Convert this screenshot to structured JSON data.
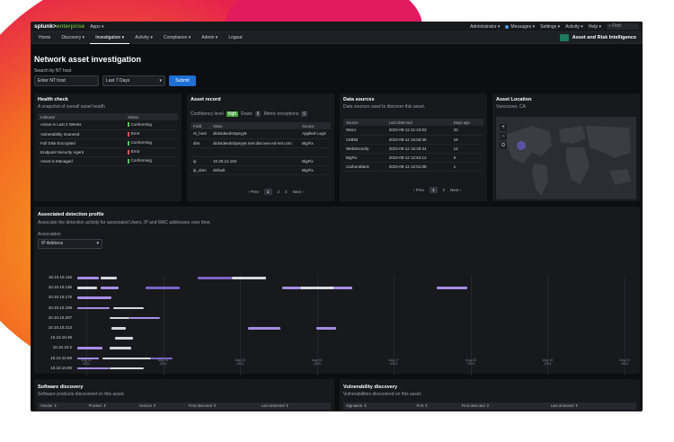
{
  "topbar": {
    "logo_main": "splunk>",
    "logo_ent": "enterprise",
    "app_menu": "Apps ▾",
    "admin": "Administrator ▾",
    "messages": "Messages ▾",
    "settings": "Settings ▾",
    "activity": "Activity ▾",
    "help": "Help ▾",
    "find": "Find"
  },
  "nav": {
    "items": [
      {
        "label": "Home"
      },
      {
        "label": "Discovery ▾"
      },
      {
        "label": "Investigation ▾"
      },
      {
        "label": "Activity ▾"
      },
      {
        "label": "Compliance ▾"
      },
      {
        "label": "Admin ▾"
      },
      {
        "label": "Logout"
      }
    ],
    "app_title": "Asset and Risk Intelligence"
  },
  "page": {
    "title": "Network asset investigation",
    "search_label": "Search by NT host",
    "input_value": "Enter NT host",
    "time_range": "Last 7 Days",
    "submit": "Submit"
  },
  "health": {
    "title": "Health check",
    "subtitle": "A snapshot of overall asset health",
    "headers": [
      "Indicator",
      "Status"
    ],
    "rows": [
      [
        "Active in Last 2 Weeks",
        "Conforming",
        "green"
      ],
      [
        "Vulnerability Scanned",
        "Error",
        "red"
      ],
      [
        "Full Disk Encrypted",
        "Conforming",
        "green"
      ],
      [
        "Endpoint Security Agent",
        "Error",
        "red"
      ],
      [
        "Asset is Managed",
        "Conforming",
        "green"
      ]
    ]
  },
  "asset": {
    "title": "Asset record",
    "conf_label": "Confidency level",
    "conf_value": "high",
    "rows_label": "Rows",
    "rows_value": "5",
    "metric_label": "Metric exceptions",
    "metric_value": "0",
    "headers": [
      "Field",
      "Value",
      "Source"
    ],
    "rows": [
      [
        "nt_host",
        "dicksdeedsSpeyy6",
        "Applied Logic"
      ],
      [
        "dns",
        "dicksdeedsSpeyy6.mer.discover.ed-net.com",
        "BigFix"
      ],
      [
        "",
        "",
        ""
      ],
      [
        "ip",
        "10.20.12.152",
        "BigFix"
      ],
      [
        "ip_dom",
        "default",
        "BigFix"
      ]
    ],
    "prev": "‹ Prev",
    "pages": [
      "1",
      "2",
      "3"
    ],
    "next": "Next ›"
  },
  "sources": {
    "title": "Data sources",
    "subtitle": "Data sources used to discover this asset.",
    "headers": [
      "Source",
      "Last detected",
      "Days ago"
    ],
    "rows": [
      [
        "Wazo",
        "2023-09-12 21:24:03",
        "20"
      ],
      [
        "CMDB",
        "2023-09-12 16:56:35",
        "18"
      ],
      [
        "WebSecurity",
        "2023-09-12 16:29:34",
        "12"
      ],
      [
        "BigFix",
        "2023-09-12 12:54:12",
        "5"
      ],
      [
        "CarbonBlack",
        "2023-09-12 12:51:08",
        "1"
      ]
    ],
    "prev": "‹ Prev",
    "pages": [
      "1",
      "2"
    ],
    "next": "Next ›"
  },
  "location": {
    "title": "Asset Location",
    "subtitle": "Vancouver, CA"
  },
  "detection": {
    "title": "Associated detection profile",
    "subtitle": "Associate the detection activity for associated Users, IP and MAC addresses over time.",
    "assoc_label": "Association",
    "assoc_value": "IP Address",
    "rows": [
      "10.10.10.116",
      "10.10.10.136",
      "10.10.10.175",
      "10.10.10.198",
      "10.10.10.207",
      "10.10.10.213",
      "10.10.10.49",
      "10.10.10.5",
      "10.10.10.69",
      "10.10.10.80"
    ],
    "ticks": [
      [
        "Aug 13",
        "2023"
      ],
      [
        "Aug 14",
        "2023"
      ],
      [
        "Aug 15",
        "2023"
      ],
      [
        "Aug 16",
        "2023"
      ],
      [
        "Aug 17",
        "2023"
      ],
      [
        "Aug 18",
        "2023"
      ],
      [
        "Aug 19",
        "2023"
      ],
      [
        "Aug 20",
        "2023"
      ]
    ]
  },
  "software": {
    "title": "Software discovery",
    "subtitle": "Software products discovered on this asset.",
    "headers": [
      "Vendor ⇕",
      "Product ⇕",
      "Version ⇕",
      "First detected ⇕",
      "Last detected ⇕"
    ]
  },
  "vuln": {
    "title": "Vulnerability discovery",
    "subtitle": "Vulnerabilities discovered on this asset.",
    "headers": [
      "Signature ⇕",
      "Port ⇕",
      "First detected ⇕",
      "Last detected ⇕"
    ]
  }
}
